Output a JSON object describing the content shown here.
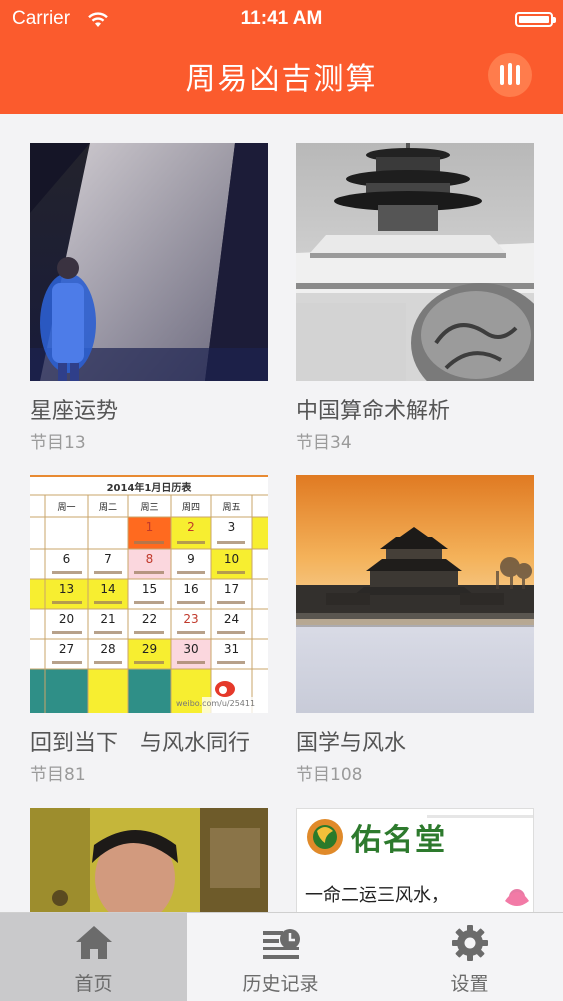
{
  "status_bar": {
    "carrier": "Carrier",
    "time": "11:41 AM"
  },
  "nav": {
    "title": "周易凶吉测算",
    "menu_icon": "bars-icon"
  },
  "cards": [
    {
      "title": "星座运势",
      "count": "节目13"
    },
    {
      "title": "中国算命术解析",
      "count": "节目34"
    },
    {
      "title": "回到当下　与风水同行",
      "count": "节目81"
    },
    {
      "title": "国学与风水",
      "count": "节目108"
    },
    {
      "title": "",
      "count": ""
    },
    {
      "title": "",
      "count": ""
    }
  ],
  "calendar": {
    "title": "2014年1月日历表",
    "weekdays": [
      "周一",
      "周二",
      "周三",
      "周四",
      "周五"
    ],
    "days": [
      "1",
      "2",
      "3",
      "6",
      "7",
      "8",
      "9",
      "10",
      "13",
      "14",
      "15",
      "16",
      "17",
      "20",
      "21",
      "22",
      "23",
      "24",
      "27",
      "28",
      "29",
      "30",
      "31"
    ],
    "watermark": "weibo.com/u/25411"
  },
  "banner": {
    "name": "佑名堂",
    "motto": "一命二运三风水，"
  },
  "tabs": [
    {
      "label": "首页",
      "icon": "home-icon",
      "active": true
    },
    {
      "label": "历史记录",
      "icon": "history-icon",
      "active": false
    },
    {
      "label": "设置",
      "icon": "gear-icon",
      "active": false
    }
  ],
  "colors": {
    "brand": "#fb5b2d",
    "tab_active": "#c9c9cb"
  }
}
